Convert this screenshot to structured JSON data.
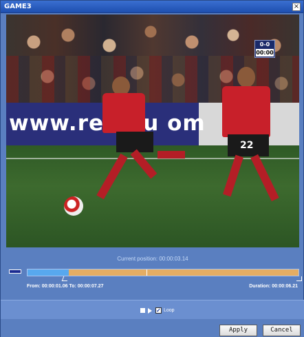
{
  "window": {
    "title": "GAME3",
    "close_glyph": "×"
  },
  "video": {
    "board_text": "www.restau   om",
    "score": "0-0",
    "clock": "00:00",
    "player_number": "22"
  },
  "player": {
    "current_position": "Current position: 00:00:03.14",
    "range_text": "From: 00:00:01.06  To: 00:00:07.27",
    "duration_text": "Duration: 00:00:06.21",
    "selection_start_fraction": 0.152,
    "cursor_fraction": 0.44,
    "loop_label": "Loop",
    "loop_checked": true,
    "check_glyph": "✓"
  },
  "buttons": {
    "apply": "Apply",
    "cancel": "Cancel"
  },
  "colors": {
    "titlebar": "#1e4fb0",
    "panel": "#5a7fc0",
    "timeline_selection": "#e4ad63",
    "timeline_before": "#58a8ee"
  },
  "icons": {
    "timeline": "timeline-icon",
    "stop": "stop-icon",
    "play": "play-icon",
    "close": "close-icon"
  }
}
